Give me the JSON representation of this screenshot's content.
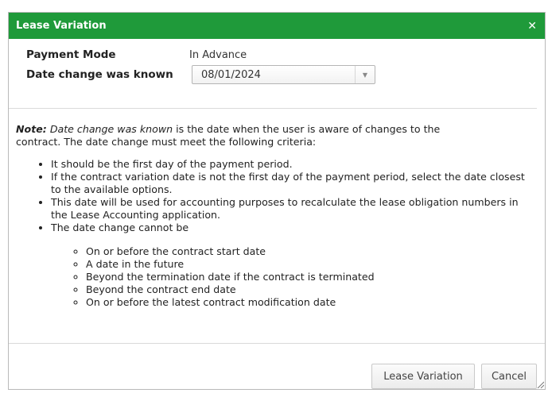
{
  "dialog": {
    "title": "Lease Variation",
    "close_icon": "close-icon"
  },
  "form": {
    "payment_mode_label": "Payment Mode",
    "payment_mode_value": "In Advance",
    "date_change_label": "Date change was known",
    "date_change_value": "08/01/2024",
    "date_change_icon": "chevron-down-icon"
  },
  "note": {
    "prefix": "Note:",
    "emphasis": "Date change was known",
    "text_line1": " is the date when the user is aware of changes to the",
    "text_line2": "contract. The date change must meet the following criteria:",
    "criteria": [
      "It should be the first day of the payment period.",
      "If the contract variation date is not the first day of the payment period, select the date closest to the available options.",
      "This date will be used for accounting purposes to recalculate the lease obligation numbers in the Lease Accounting application.",
      "The date change cannot be"
    ],
    "cannot_be": [
      "On or before the contract start date",
      "A date in the future",
      "Beyond the termination date if the contract is terminated",
      "Beyond the contract end date",
      "On or before the latest contract modification date"
    ]
  },
  "footer": {
    "lease_variation_label": "Lease Variation",
    "cancel_label": "Cancel",
    "resize_icon": "resize-grip-icon"
  },
  "colors": {
    "header_green": "#1f9a3a"
  }
}
